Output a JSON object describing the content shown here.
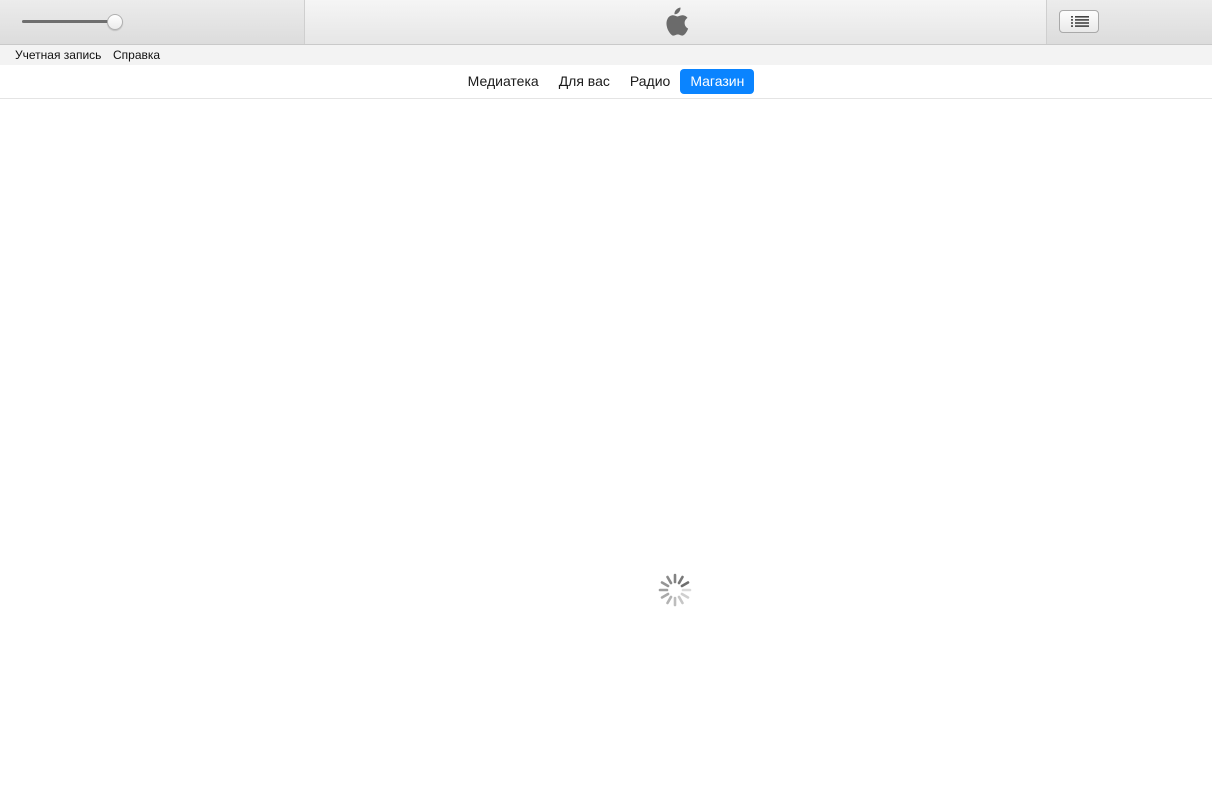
{
  "toolbar": {
    "volume": 0.93,
    "logo_icon": "apple-logo-icon",
    "list_icon": "list-icon"
  },
  "menubar": {
    "items": [
      {
        "label": "Учетная запись"
      },
      {
        "label": "Справка"
      }
    ]
  },
  "tabs": [
    {
      "label": "Медиатека",
      "active": false
    },
    {
      "label": "Для вас",
      "active": false
    },
    {
      "label": "Радио",
      "active": false
    },
    {
      "label": "Магазин",
      "active": true
    }
  ],
  "content": {
    "state_icon": "loading-spinner-icon"
  },
  "colors": {
    "accent": "#0a84ff",
    "spinner": "#6e6e6e"
  }
}
